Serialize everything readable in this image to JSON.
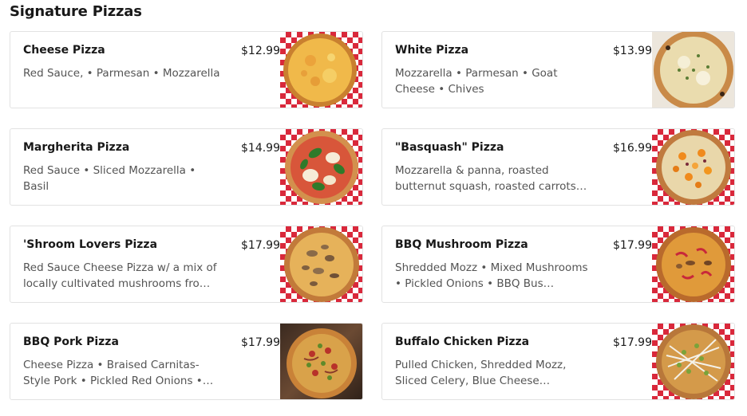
{
  "section": {
    "title": "Signature Pizzas"
  },
  "items": [
    {
      "name": "Cheese Pizza",
      "price": "$12.99",
      "description": "Red Sauce, • Parmesan • Mozzarella",
      "image_icon": "cheese-pizza-photo"
    },
    {
      "name": "White Pizza",
      "price": "$13.99",
      "description": "Mozzarella • Parmesan • Goat Cheese • Chives",
      "image_icon": "white-pizza-photo"
    },
    {
      "name": "Margherita Pizza",
      "price": "$14.99",
      "description": "Red Sauce • Sliced Mozzarella • Basil",
      "image_icon": "margherita-pizza-photo"
    },
    {
      "name": "\"Basquash\" Pizza",
      "price": "$16.99",
      "description": "Mozzarella & panna, roasted butternut squash, roasted carrots…",
      "image_icon": "basquash-pizza-photo"
    },
    {
      "name": "'Shroom Lovers Pizza",
      "price": "$17.99",
      "description": "Red Sauce Cheese Pizza w/ a mix of locally cultivated mushrooms fro…",
      "image_icon": "shroom-lovers-pizza-photo"
    },
    {
      "name": "BBQ Mushroom Pizza",
      "price": "$17.99",
      "description": "Shredded Mozz • Mixed Mushrooms • Pickled Onions • BBQ Bus…",
      "image_icon": "bbq-mushroom-pizza-photo"
    },
    {
      "name": "BBQ Pork Pizza",
      "price": "$17.99",
      "description": "Cheese Pizza • Braised Carnitas-Style Pork • Pickled Red Onions •…",
      "image_icon": "bbq-pork-pizza-photo"
    },
    {
      "name": "Buffalo Chicken Pizza",
      "price": "$17.99",
      "description": "Pulled Chicken, Shredded Mozz, Sliced Celery, Blue Cheese…",
      "image_icon": "buffalo-chicken-pizza-photo"
    }
  ],
  "colors": {
    "text_primary": "#191919",
    "text_secondary": "#545454",
    "card_border": "#e2e2e2",
    "checker_red": "#d9283b"
  }
}
